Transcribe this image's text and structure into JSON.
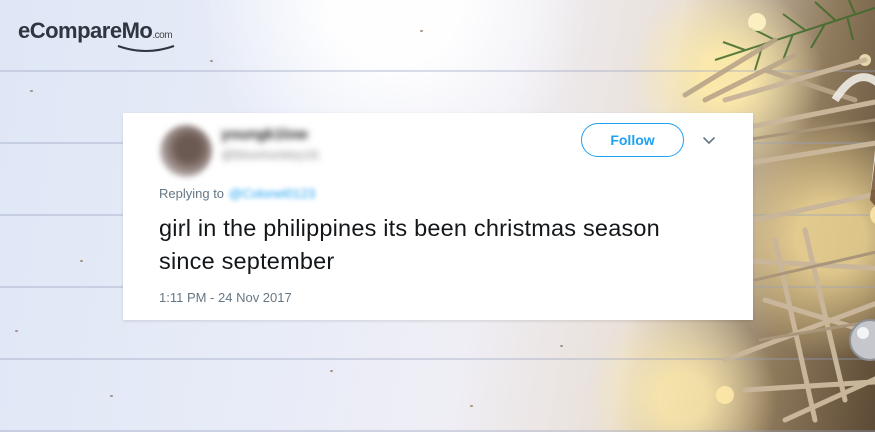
{
  "brand": {
    "logo_text": "eCompareMo",
    "logo_suffix": ".com"
  },
  "tweet": {
    "display_name": "youngk1low",
    "handle": "@bloomonkey16",
    "follow_label": "Follow",
    "replying_label": "Replying to",
    "replying_to": "@Colonel0123",
    "text": "girl in the philippines its been christmas season since september",
    "timestamp": "1:11 PM - 24 Nov 2017"
  },
  "colors": {
    "accent": "#1da1f2",
    "muted": "#657786",
    "text": "#14171a"
  }
}
